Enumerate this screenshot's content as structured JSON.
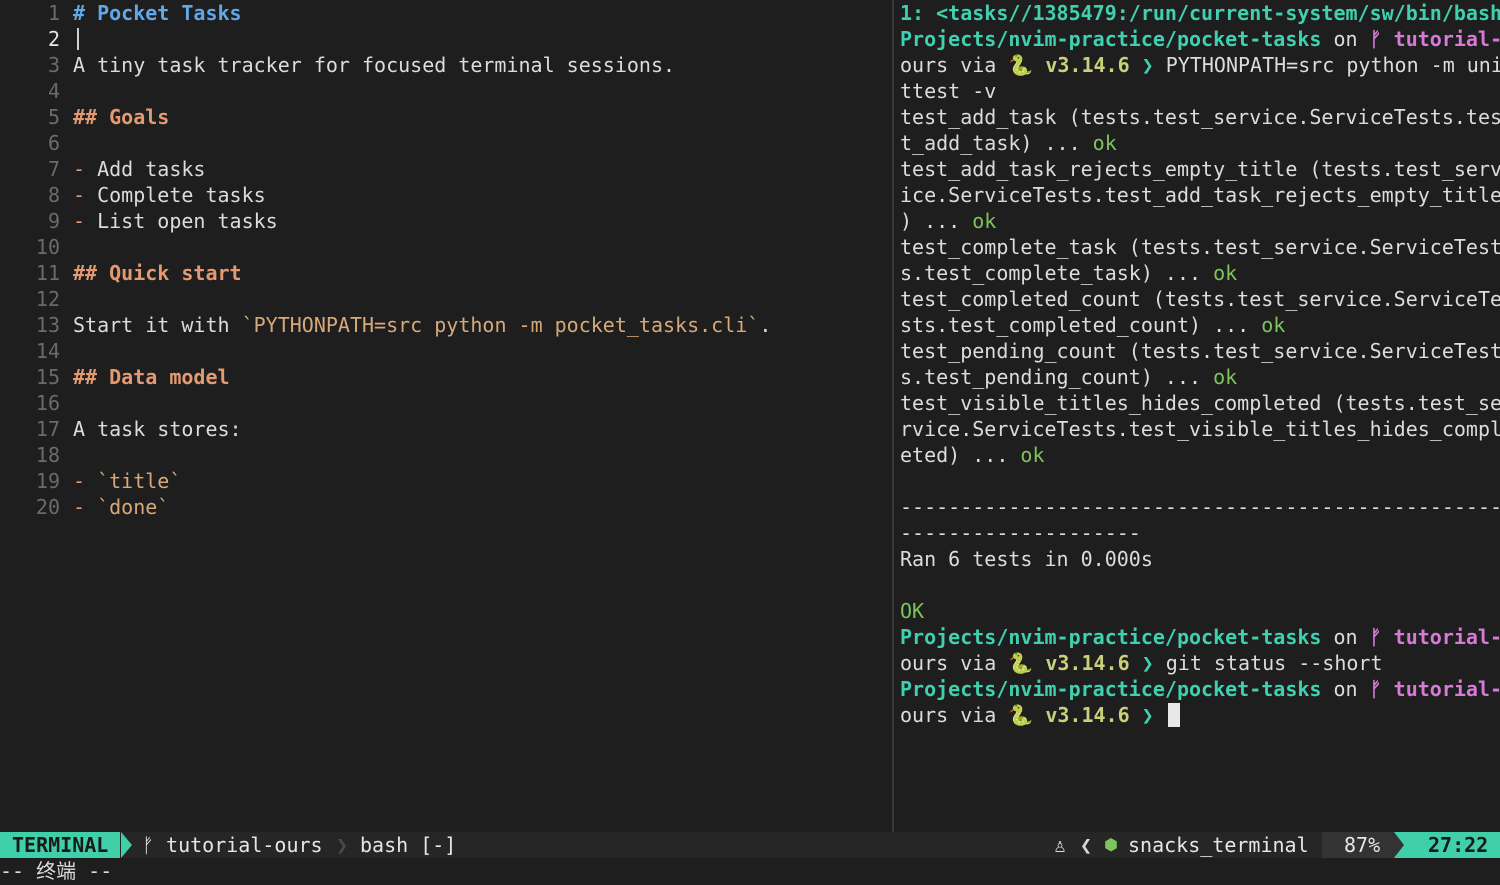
{
  "editor": {
    "lines": [
      {
        "n": "1",
        "parts": [
          {
            "t": "# Pocket Tasks",
            "c": "h1"
          }
        ]
      },
      {
        "n": "2",
        "parts": []
      },
      {
        "n": "3",
        "parts": [
          {
            "t": "A tiny task tracker for focused terminal sessions.",
            "c": ""
          }
        ]
      },
      {
        "n": "4",
        "parts": []
      },
      {
        "n": "5",
        "parts": [
          {
            "t": "## Goals",
            "c": "h2"
          }
        ]
      },
      {
        "n": "6",
        "parts": []
      },
      {
        "n": "7",
        "parts": [
          {
            "t": "-",
            "c": "dash"
          },
          {
            "t": " Add tasks",
            "c": ""
          }
        ]
      },
      {
        "n": "8",
        "parts": [
          {
            "t": "-",
            "c": "dash"
          },
          {
            "t": " Complete tasks",
            "c": ""
          }
        ]
      },
      {
        "n": "9",
        "parts": [
          {
            "t": "-",
            "c": "dash"
          },
          {
            "t": " List open tasks",
            "c": ""
          }
        ]
      },
      {
        "n": "10",
        "parts": []
      },
      {
        "n": "11",
        "parts": [
          {
            "t": "## Quick start",
            "c": "h2"
          }
        ]
      },
      {
        "n": "12",
        "parts": []
      },
      {
        "n": "13",
        "parts": [
          {
            "t": "Start it with ",
            "c": ""
          },
          {
            "t": "`PYTHONPATH=src python -m pocket_tasks.cli`",
            "c": "code"
          },
          {
            "t": ".",
            "c": ""
          }
        ]
      },
      {
        "n": "14",
        "parts": []
      },
      {
        "n": "15",
        "parts": [
          {
            "t": "## Data model",
            "c": "h2"
          }
        ]
      },
      {
        "n": "16",
        "parts": []
      },
      {
        "n": "17",
        "parts": [
          {
            "t": "A task stores:",
            "c": ""
          }
        ]
      },
      {
        "n": "18",
        "parts": []
      },
      {
        "n": "19",
        "parts": [
          {
            "t": "-",
            "c": "dash"
          },
          {
            "t": " ",
            "c": ""
          },
          {
            "t": "`title`",
            "c": "code"
          }
        ]
      },
      {
        "n": "20",
        "parts": [
          {
            "t": "-",
            "c": "dash"
          },
          {
            "t": " ",
            "c": ""
          },
          {
            "t": "`done`",
            "c": "code"
          }
        ]
      }
    ]
  },
  "terminal": {
    "lines": [
      [
        {
          "t": "1: <tasks//1385479:/run/current-system/sw/bin/bash",
          "c": "prompt"
        }
      ],
      [
        {
          "t": "Projects/nvim-practice/pocket-tasks",
          "c": "path"
        },
        {
          "t": " on ",
          "c": ""
        },
        {
          "t": "ᚠ tutorial-",
          "c": "branch"
        }
      ],
      [
        {
          "t": "ours via ",
          "c": ""
        },
        {
          "t": "🐍 v3.14.6 ",
          "c": "ver"
        },
        {
          "t": "❯",
          "c": "prompt"
        },
        {
          "t": " PYTHONPATH=src python -m uni",
          "c": ""
        }
      ],
      [
        {
          "t": "ttest -v",
          "c": ""
        }
      ],
      [
        {
          "t": "test_add_task (tests.test_service.ServiceTests.tes",
          "c": ""
        }
      ],
      [
        {
          "t": "t_add_task) ... ",
          "c": ""
        },
        {
          "t": "ok",
          "c": "ok"
        }
      ],
      [
        {
          "t": "test_add_task_rejects_empty_title (tests.test_serv",
          "c": ""
        }
      ],
      [
        {
          "t": "ice.ServiceTests.test_add_task_rejects_empty_title",
          "c": ""
        }
      ],
      [
        {
          "t": ") ... ",
          "c": ""
        },
        {
          "t": "ok",
          "c": "ok"
        }
      ],
      [
        {
          "t": "test_complete_task (tests.test_service.ServiceTest",
          "c": ""
        }
      ],
      [
        {
          "t": "s.test_complete_task) ... ",
          "c": ""
        },
        {
          "t": "ok",
          "c": "ok"
        }
      ],
      [
        {
          "t": "test_completed_count (tests.test_service.ServiceTe",
          "c": ""
        }
      ],
      [
        {
          "t": "sts.test_completed_count) ... ",
          "c": ""
        },
        {
          "t": "ok",
          "c": "ok"
        }
      ],
      [
        {
          "t": "test_pending_count (tests.test_service.ServiceTest",
          "c": ""
        }
      ],
      [
        {
          "t": "s.test_pending_count) ... ",
          "c": ""
        },
        {
          "t": "ok",
          "c": "ok"
        }
      ],
      [
        {
          "t": "test_visible_titles_hides_completed (tests.test_se",
          "c": ""
        }
      ],
      [
        {
          "t": "rvice.ServiceTests.test_visible_titles_hides_compl",
          "c": ""
        }
      ],
      [
        {
          "t": "eted) ... ",
          "c": ""
        },
        {
          "t": "ok",
          "c": "ok"
        }
      ],
      [],
      [
        {
          "t": "--------------------------------------------------",
          "c": ""
        }
      ],
      [
        {
          "t": "--------------------",
          "c": ""
        }
      ],
      [
        {
          "t": "Ran 6 tests in 0.000s",
          "c": ""
        }
      ],
      [],
      [
        {
          "t": "OK",
          "c": "ok"
        }
      ],
      [
        {
          "t": "Projects/nvim-practice/pocket-tasks",
          "c": "path"
        },
        {
          "t": " on ",
          "c": ""
        },
        {
          "t": "ᚠ tutorial-",
          "c": "branch"
        }
      ],
      [
        {
          "t": "ours via ",
          "c": ""
        },
        {
          "t": "🐍 v3.14.6 ",
          "c": "ver"
        },
        {
          "t": "❯",
          "c": "prompt"
        },
        {
          "t": " git status --short",
          "c": ""
        }
      ],
      [
        {
          "t": "Projects/nvim-practice/pocket-tasks",
          "c": "path"
        },
        {
          "t": " on ",
          "c": ""
        },
        {
          "t": "ᚠ tutorial-",
          "c": "branch"
        }
      ],
      [
        {
          "t": "ours via ",
          "c": ""
        },
        {
          "t": "🐍 v3.14.6 ",
          "c": "ver"
        },
        {
          "t": "❯",
          "c": "prompt"
        },
        {
          "t": " ",
          "c": "",
          "cursor": true
        }
      ]
    ]
  },
  "statusbar": {
    "mode": "TERMINAL",
    "branch_icon": "ᚠ",
    "branch": "tutorial-ours",
    "separator": "❯",
    "file": "bash [-]",
    "lock_icon": "♙",
    "less_than": "❮",
    "filetype_icon": "⬢",
    "filetype": "snacks_terminal",
    "percent": "87%",
    "position": "27:22"
  },
  "message": "-- 终端 --"
}
